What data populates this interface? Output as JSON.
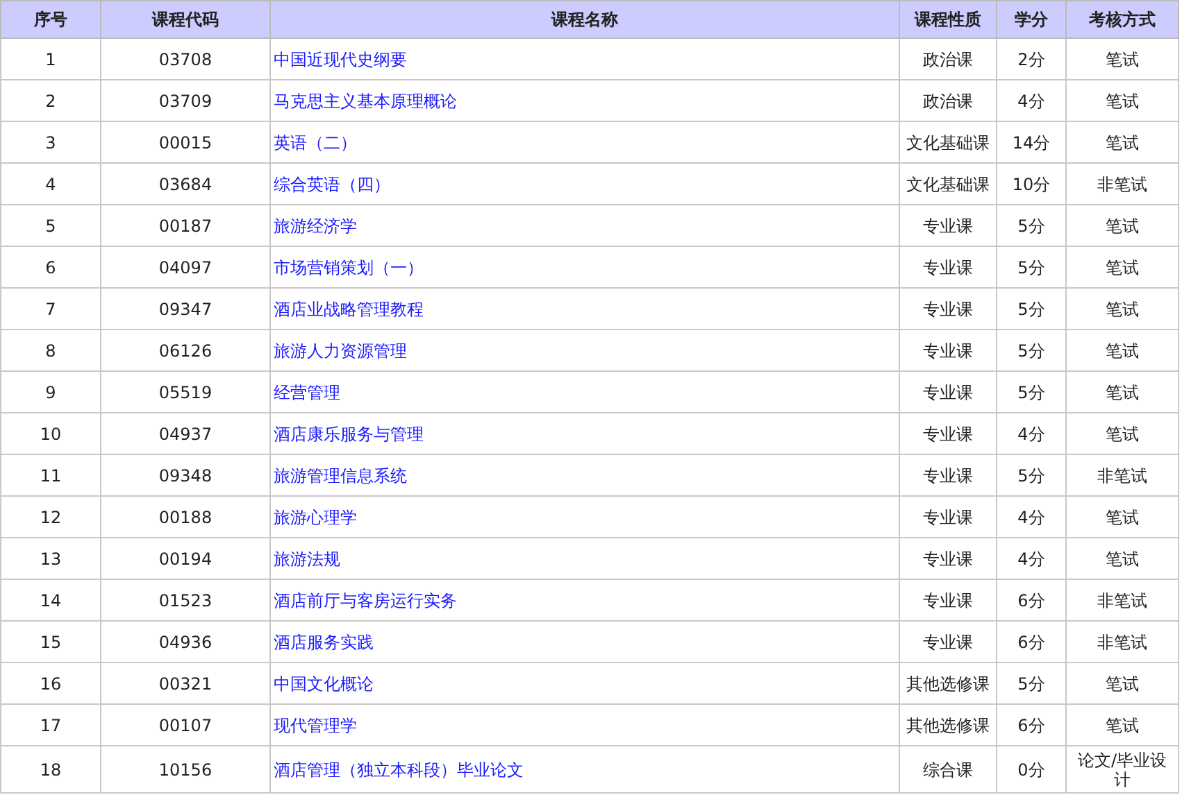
{
  "table": {
    "columns": [
      "序号",
      "课程代码",
      "课程名称",
      "课程性质",
      "学分",
      "考核方式"
    ],
    "rows": [
      [
        "1",
        "03708",
        "中国近现代史纲要",
        "政治课",
        "2分",
        "笔试"
      ],
      [
        "2",
        "03709",
        "马克思主义基本原理概论",
        "政治课",
        "4分",
        "笔试"
      ],
      [
        "3",
        "00015",
        "英语（二）",
        "文化基础课",
        "14分",
        "笔试"
      ],
      [
        "4",
        "03684",
        "综合英语（四）",
        "文化基础课",
        "10分",
        "非笔试"
      ],
      [
        "5",
        "00187",
        "旅游经济学",
        "专业课",
        "5分",
        "笔试"
      ],
      [
        "6",
        "04097",
        "市场营销策划（一）",
        "专业课",
        "5分",
        "笔试"
      ],
      [
        "7",
        "09347",
        "酒店业战略管理教程",
        "专业课",
        "5分",
        "笔试"
      ],
      [
        "8",
        "06126",
        "旅游人力资源管理",
        "专业课",
        "5分",
        "笔试"
      ],
      [
        "9",
        "05519",
        "经营管理",
        "专业课",
        "5分",
        "笔试"
      ],
      [
        "10",
        "04937",
        "酒店康乐服务与管理",
        "专业课",
        "4分",
        "笔试"
      ],
      [
        "11",
        "09348",
        "旅游管理信息系统",
        "专业课",
        "5分",
        "非笔试"
      ],
      [
        "12",
        "00188",
        "旅游心理学",
        "专业课",
        "4分",
        "笔试"
      ],
      [
        "13",
        "00194",
        "旅游法规",
        "专业课",
        "4分",
        "笔试"
      ],
      [
        "14",
        "01523",
        "酒店前厅与客房运行实务",
        "专业课",
        "6分",
        "非笔试"
      ],
      [
        "15",
        "04936",
        "酒店服务实践",
        "专业课",
        "6分",
        "非笔试"
      ],
      [
        "16",
        "00321",
        "中国文化概论",
        "其他选修课",
        "5分",
        "笔试"
      ],
      [
        "17",
        "00107",
        "现代管理学",
        "其他选修课",
        "6分",
        "笔试"
      ],
      [
        "18",
        "10156",
        "酒店管理（独立本科段）毕业论文",
        "综合课",
        "0分",
        "论文/毕业设计"
      ]
    ]
  }
}
